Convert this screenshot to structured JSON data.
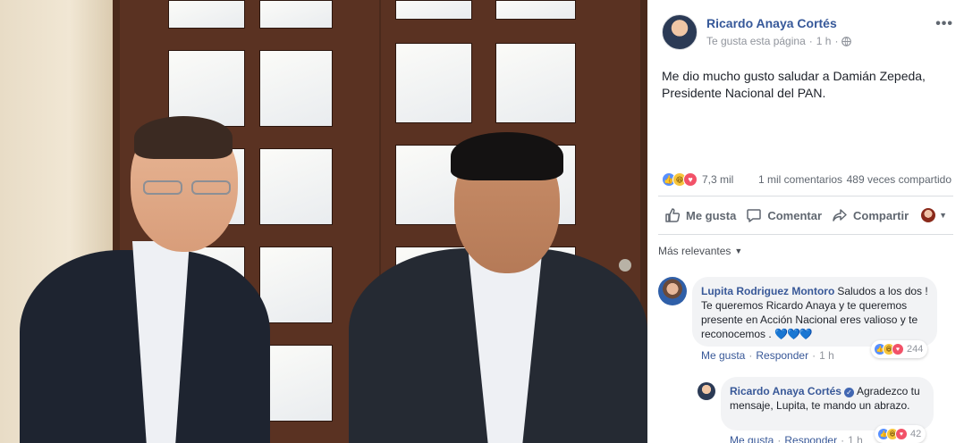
{
  "post": {
    "author": "Ricardo Anaya Cortés",
    "meta_label": "Te gusta esta página",
    "meta_sep": "·",
    "meta_time": "1 h",
    "meta_sep2": "·",
    "more_label": "•••",
    "text": "Me dio mucho gusto saludar a Damián Zepeda, Presidente Nacional del PAN.",
    "icons": {
      "more": "more-icon",
      "privacy": "globe-icon"
    }
  },
  "stats": {
    "reactions_count": "7,3 mil",
    "comments": "1 mil comentarios",
    "shares": "489 veces compartido",
    "reaction_types": [
      "like",
      "haha",
      "love"
    ]
  },
  "actions": {
    "like": "Me gusta",
    "comment": "Comentar",
    "share": "Compartir"
  },
  "comments_filter": "Más relevantes",
  "comments": [
    {
      "author": "Lupita Rodriguez Montoro",
      "text": "Saludos a los dos ! Te queremos Ricardo Anaya y te queremos presente en Acción Nacional eres valioso y te reconocemos .",
      "emoji": "💙💙💙",
      "reaction_count": "244",
      "like": "Me gusta",
      "reply": "Responder",
      "time": "1 h"
    },
    {
      "author": "Ricardo Anaya Cortés",
      "verified_mark": "✓",
      "text": "Agradezco tu mensaje, Lupita, te mando un abrazo.",
      "reaction_count": "42",
      "like": "Me gusta",
      "reply": "Responder",
      "time": "1 h"
    }
  ],
  "colors": {
    "link": "#365899",
    "meta": "#90949c",
    "like_blue": "#5890ff",
    "love_red": "#f25268",
    "haha_yellow": "#f7c53c",
    "bubble": "#f2f3f5"
  }
}
